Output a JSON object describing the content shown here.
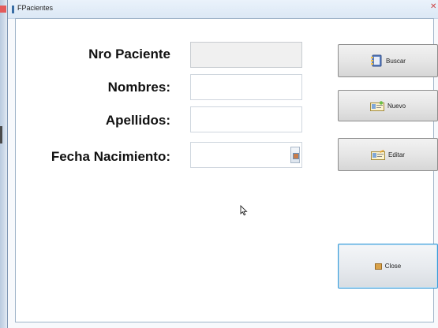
{
  "window": {
    "title": "FPacientes"
  },
  "form": {
    "nro_paciente_label": "Nro Paciente",
    "nro_paciente_value": "",
    "nombres_label": "Nombres:",
    "nombres_value": "",
    "apellidos_label": "Apellidos:",
    "apellidos_value": "",
    "fecha_label": "Fecha Nacimiento:",
    "fecha_value": ""
  },
  "buttons": {
    "buscar": "Buscar",
    "nuevo": "Nuevo",
    "editar": "Editar",
    "close": "Close"
  },
  "icons": {
    "buscar": "address-book-icon",
    "nuevo": "id-card-new-icon",
    "editar": "id-card-edit-icon",
    "close": "close-box-icon",
    "calendar": "calendar-icon",
    "cursor": "mouse-pointer-icon"
  }
}
